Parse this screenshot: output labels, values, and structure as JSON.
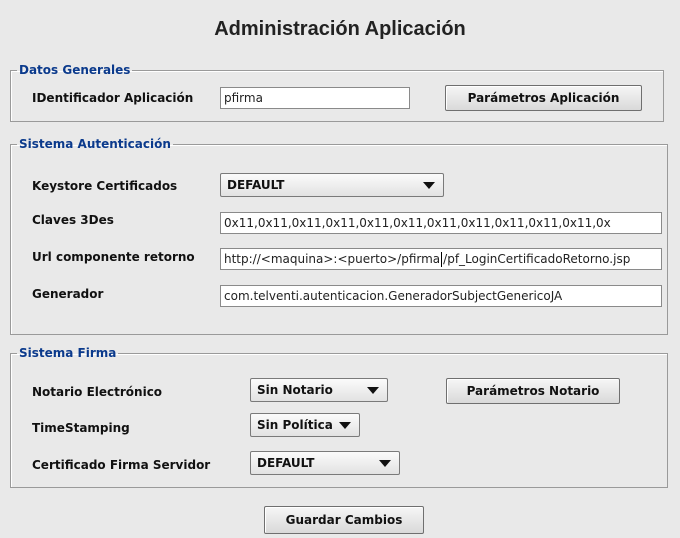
{
  "title": "Administración Aplicación",
  "datos_generales": {
    "legend": "Datos Generales",
    "identificador_label": "IDentificador Aplicación",
    "identificador_value": "pfirma",
    "parametros_button": "Parámetros Aplicación"
  },
  "sistema_autenticacion": {
    "legend": "Sistema Autenticación",
    "keystore_label": "Keystore Certificados",
    "keystore_value": "DEFAULT",
    "claves_label": "Claves 3Des",
    "claves_value": "0x11,0x11,0x11,0x11,0x11,0x11,0x11,0x11,0x11,0x11,0x11,0x",
    "url_label": "Url componente retorno",
    "url_value_before_caret": "http://<maquina>:<puerto>/pfirma",
    "url_value_after_caret": "/pf_LoginCertificadoRetorno.jsp",
    "generador_label": "Generador",
    "generador_value": "com.telventi.autenticacion.GeneradorSubjectGenericoJA"
  },
  "sistema_firma": {
    "legend": "Sistema Firma",
    "notario_label": "Notario Electrónico",
    "notario_value": "Sin Notario",
    "parametros_notario_button": "Parámetros Notario",
    "timestamping_label": "TimeStamping",
    "timestamping_value": "Sin Política",
    "certificado_label": "Certificado Firma Servidor",
    "certificado_value": "DEFAULT"
  },
  "guardar_button": "Guardar Cambios",
  "icons": {
    "dropdown": "chevron-down-icon"
  }
}
